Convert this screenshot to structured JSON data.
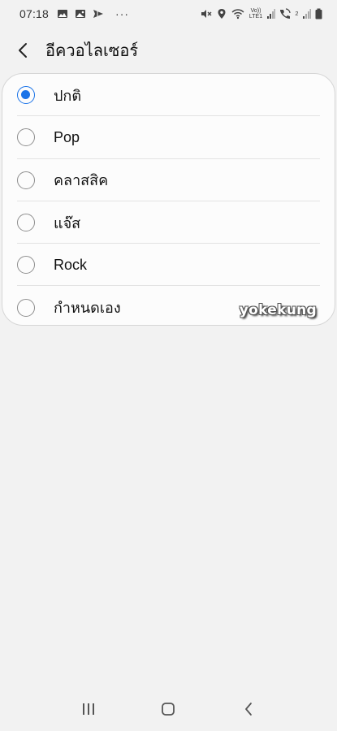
{
  "status_bar": {
    "time": "07:18",
    "left_icons": [
      "image-icon",
      "gallery-icon",
      "send-icon"
    ],
    "more": "···",
    "right_icons": [
      "mute-icon",
      "location-icon",
      "wifi-icon",
      "volte-icon",
      "signal-icon",
      "call-wifi-icon",
      "signal-icon",
      "battery-icon"
    ],
    "volte_label": "Vo)) LTE1",
    "sim2_label": "2"
  },
  "header": {
    "title": "อีควอไลเซอร์"
  },
  "options": [
    {
      "label": "ปกติ",
      "checked": true
    },
    {
      "label": "Pop",
      "checked": false
    },
    {
      "label": "คลาสสิค",
      "checked": false
    },
    {
      "label": "แจ๊ส",
      "checked": false
    },
    {
      "label": "Rock",
      "checked": false
    },
    {
      "label": "กำหนดเอง",
      "checked": false
    }
  ],
  "watermark": "yokekung",
  "colors": {
    "accent": "#1a73e8",
    "background": "#f2f2f2",
    "card": "#fcfcfc"
  }
}
